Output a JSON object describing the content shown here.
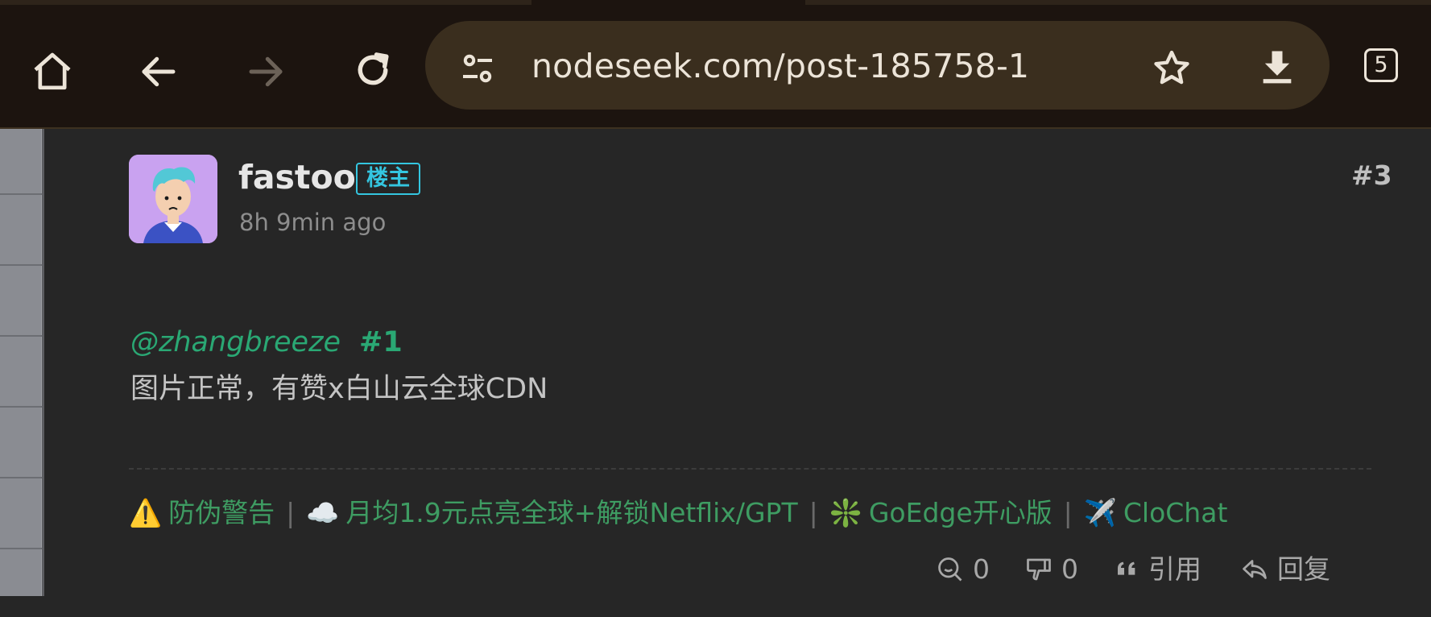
{
  "browser": {
    "url": "nodeseek.com/post-185758-1",
    "tab_count": "5",
    "icons": [
      "home-icon",
      "back-icon",
      "forward-icon",
      "reload-icon",
      "site-settings-icon",
      "bookmark-star-icon",
      "download-icon",
      "tab-count-icon"
    ]
  },
  "post": {
    "author": "fastoo",
    "op_badge": "楼主",
    "time": "8h 9min ago",
    "floor": "#3",
    "mention": "@zhangbreeze",
    "mention_floor": "#1",
    "text": "图片正常，有赞x白山云全球CDN"
  },
  "signature": {
    "links": [
      {
        "emoji": "⚠️",
        "label": "防伪警告"
      },
      {
        "emoji": "☁️",
        "label": "月均1.9元点亮全球+解锁Netflix/GPT"
      },
      {
        "emoji": "❇️",
        "label": "GoEdge开心版"
      },
      {
        "emoji": "✈️",
        "label": "CloChat"
      }
    ],
    "separator": "|"
  },
  "actions": {
    "like_count": "0",
    "dislike_count": "0",
    "quote_label": "引用",
    "reply_label": "回复"
  },
  "colors": {
    "toolbar_bg": "#1c140f",
    "urlbar_bg": "#3a2e1e",
    "page_bg": "#262626",
    "mention_green": "#2aa874",
    "badge_cyan": "#34c6e0",
    "signature_green": "#3e9c62"
  }
}
